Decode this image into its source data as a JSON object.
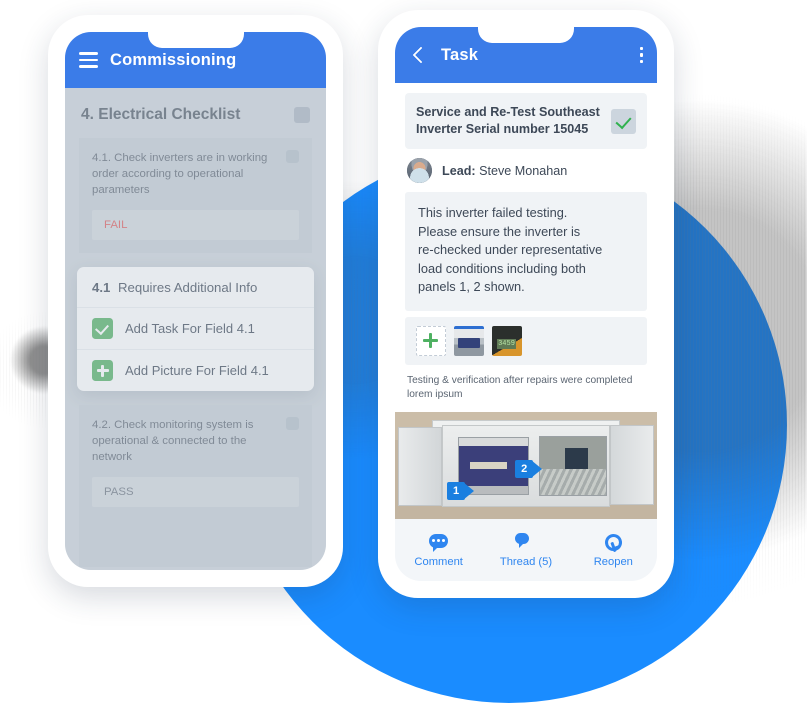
{
  "left_phone": {
    "appbar": {
      "menu_icon": "hamburger-icon",
      "title": "Commissioning"
    },
    "section": {
      "title": "4. Electrical Checklist"
    },
    "items": [
      {
        "question": "4.1. Check inverters are in working order according to operational parameters",
        "answer": "FAIL",
        "answer_state": "fail"
      },
      {
        "question": "4.2. Check monitoring system is operational & connected to the network",
        "answer": "PASS",
        "answer_state": "pass"
      }
    ],
    "popover": {
      "number": "4.1",
      "title": "Requires Additional Info",
      "options": [
        {
          "icon": "check-icon",
          "label": "Add Task For Field 4.1"
        },
        {
          "icon": "plus-icon",
          "label": "Add Picture For Field 4.1"
        }
      ]
    }
  },
  "right_phone": {
    "appbar": {
      "back_icon": "back-arrow-icon",
      "title": "Task",
      "more_icon": "kebab-menu-icon"
    },
    "task": {
      "title": "Service and Re-Test Southeast Inverter Serial number 15045",
      "completed_icon": "check-icon"
    },
    "lead": {
      "label": "Lead:",
      "name": "Steve Monahan",
      "avatar": "user-avatar"
    },
    "description": "This inverter failed testing.\nPlease  ensure the inverter is\nre-checked under representative\nload conditions including both\npanels 1, 2 shown.",
    "attachments": {
      "add_label": "add-photo-tile",
      "thumbs": [
        "inverter-cabinet-thumbnail",
        "meter-display-thumbnail"
      ],
      "meter_reading": "3459"
    },
    "caption": "Testing & verification after repairs were completed lorem ipsum",
    "photo": {
      "alt": "inverter-cabinet-photo",
      "markers": [
        {
          "number": "1"
        },
        {
          "number": "2"
        }
      ]
    },
    "bottom_nav": [
      {
        "icon": "comment-icon",
        "label": "Comment"
      },
      {
        "icon": "thread-icon",
        "label": "Thread (5)"
      },
      {
        "icon": "reopen-key-icon",
        "label": "Reopen"
      }
    ]
  },
  "colors": {
    "appbar_blue": "#3b7ce8",
    "accent_blue": "#2f86f0",
    "background_circle": "#1a8cff",
    "green": "#4fb162",
    "fail_red": "#e05a5a",
    "dim_screen": "#cdd4db"
  }
}
